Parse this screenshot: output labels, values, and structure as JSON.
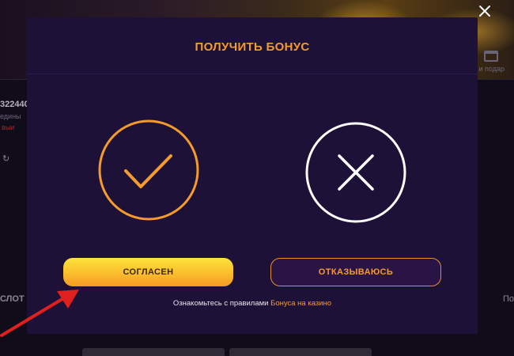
{
  "modal": {
    "title": "ПОЛУЧИТЬ БОНУС",
    "agree_label": "СОГЛАСЕН",
    "decline_label": "ОТКАЗЫВАЮСЬ",
    "rules_text": "Ознакомьтесь с правилами",
    "rules_link": "Бонуса на казино"
  },
  "background": {
    "left_number": "322440",
    "left_sub": "едины",
    "left_red": "выи",
    "left_icon": "↻",
    "left_slots": "СЛОТ",
    "right_text": "и и подар",
    "right_letter": "По"
  },
  "icons": {
    "close": "close-icon",
    "agree": "check-circle-icon",
    "decline": "x-circle-icon",
    "arrow": "arrow-annotation"
  },
  "colors": {
    "accent": "#f59b2b",
    "modal_bg": "#1d1137",
    "agree_button": "#fbbd2c",
    "arrow": "#e0201c"
  }
}
